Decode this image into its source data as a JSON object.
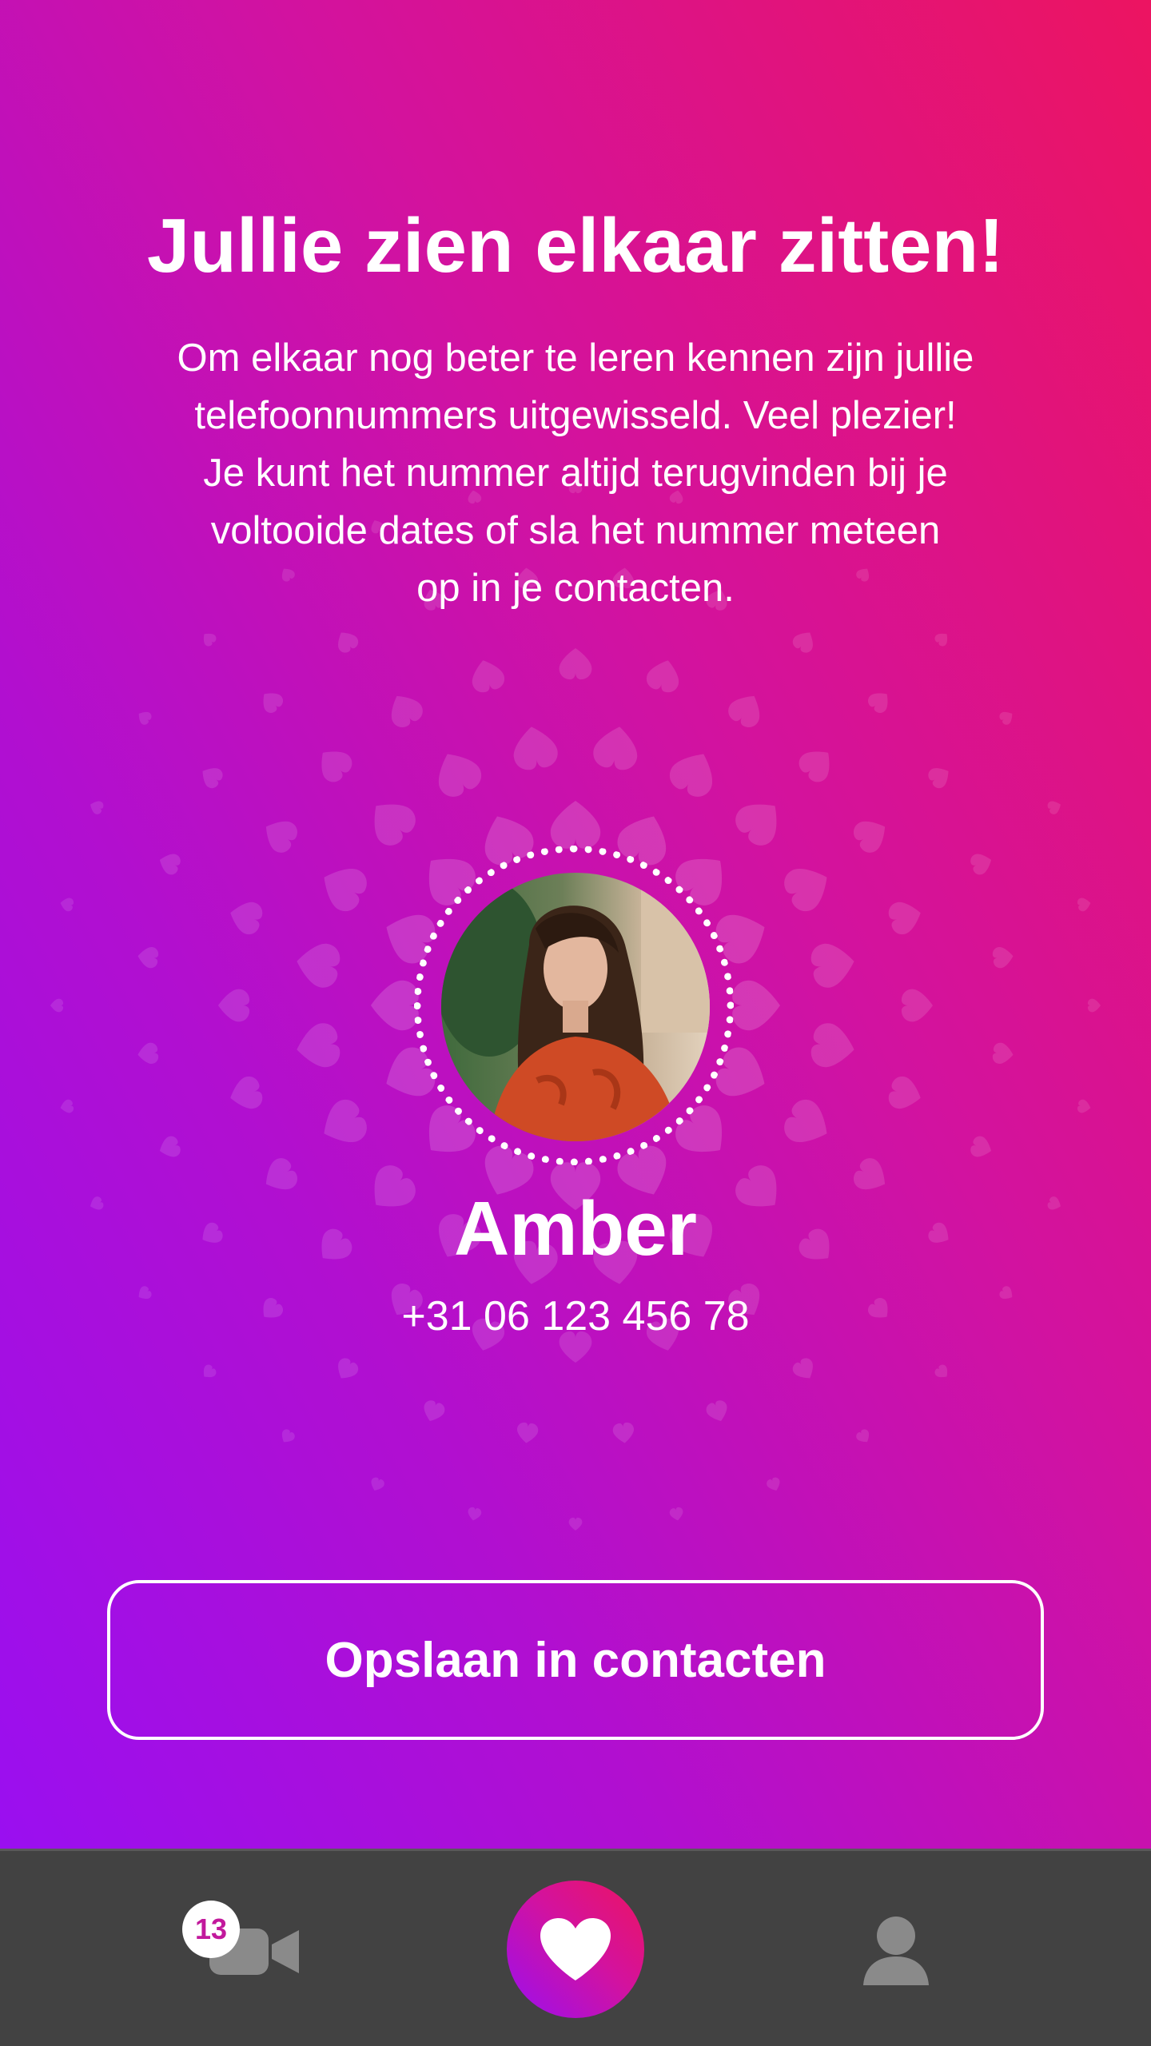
{
  "match": {
    "title": "Jullie zien elkaar zitten!",
    "description_lines": [
      "Om elkaar nog beter te leren kennen zijn jullie",
      "telefoonnummers uitgewisseld. Veel plezier!",
      "Je kunt het nummer altijd terugvinden bij je",
      "voltooide dates of sla het nummer meteen",
      "op in je contacten."
    ],
    "name": "Amber",
    "phone": "+31 06 123 456 78",
    "save_label": "Opslaan in contacten"
  },
  "nav": {
    "video_badge": "13",
    "items": [
      "video-icon",
      "heart-icon",
      "profile-icon"
    ]
  },
  "colors": {
    "gradient_start": "#9a0ff0",
    "gradient_end": "#ec1461",
    "navbar": "#424242",
    "nav_icon": "#8a8a8a",
    "badge_text": "#c2199c"
  }
}
